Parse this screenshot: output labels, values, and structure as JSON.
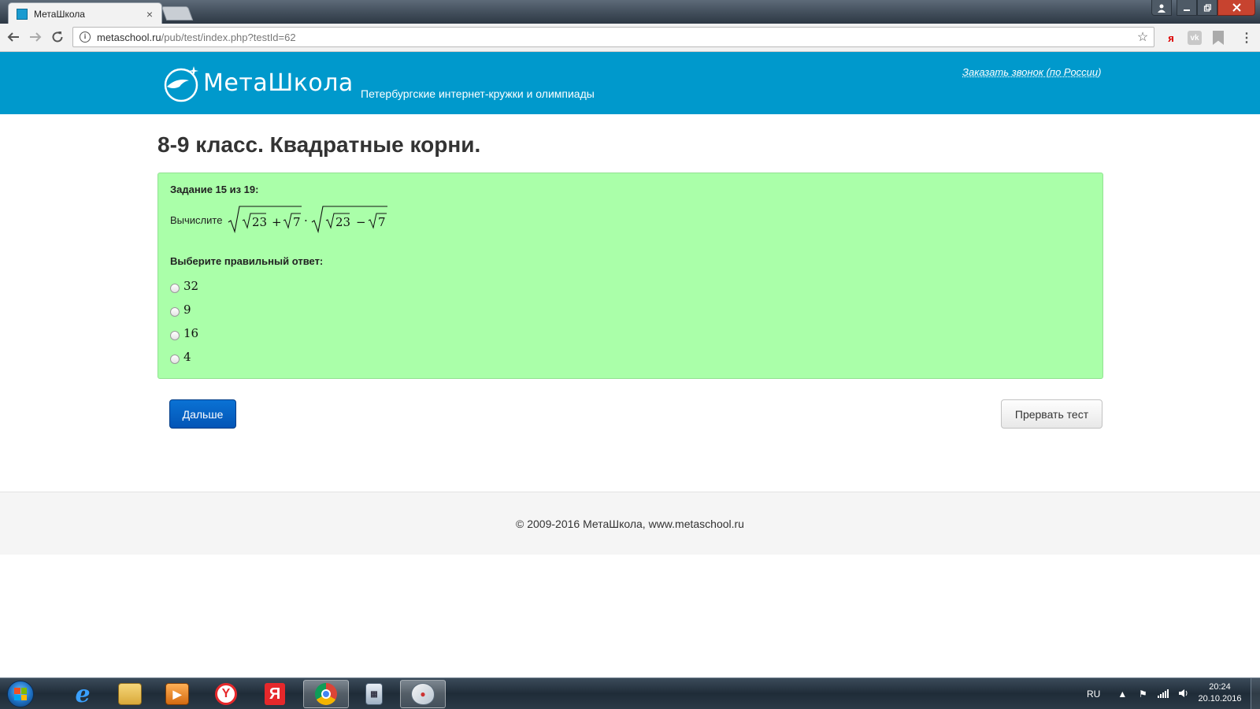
{
  "browser": {
    "tab_title": "МетаШкола",
    "tab_close": "×",
    "url_host": "metaschool.ru",
    "url_path": "/pub/test/index.php?testId=62",
    "icons": {
      "back": "arrow-left-icon",
      "forward": "arrow-right-icon",
      "reload": "reload-icon",
      "info": "info-icon",
      "bookmark": "star-icon",
      "menu": "kebab-menu-icon"
    },
    "ext_yandex_label": "я",
    "ext_vk_label": "vk"
  },
  "header": {
    "logo_text": "МетаШкола",
    "tagline": "Петербургские интернет-кружки и олимпиады",
    "callback_link": "Заказать звонок (по России)",
    "bg_color": "#0099cc"
  },
  "main": {
    "title": "8-9 класс. Квадратные корни.",
    "task": {
      "header": "Задание 15 из 19:",
      "question_prefix": "Вычислите",
      "formula_parts": [
        "23",
        "+",
        "7",
        "·",
        "23",
        "−",
        "7"
      ],
      "choose_label": "Выберите правильный ответ:",
      "options": [
        "32",
        "9",
        "16",
        "4"
      ],
      "panel_color": "#aaffa9"
    },
    "next_button": "Дальше",
    "abort_button": "Прервать тест"
  },
  "footer": {
    "text": "© 2009-2016 МетаШкола, www.metaschool.ru"
  },
  "taskbar": {
    "apps": [
      "start-orb",
      "internet-explorer",
      "file-explorer",
      "media-player",
      "yandex-browser",
      "yandex",
      "chrome",
      "calculator",
      "paint"
    ],
    "lang": "RU",
    "time": "20:24",
    "date": "20.10.2016"
  }
}
